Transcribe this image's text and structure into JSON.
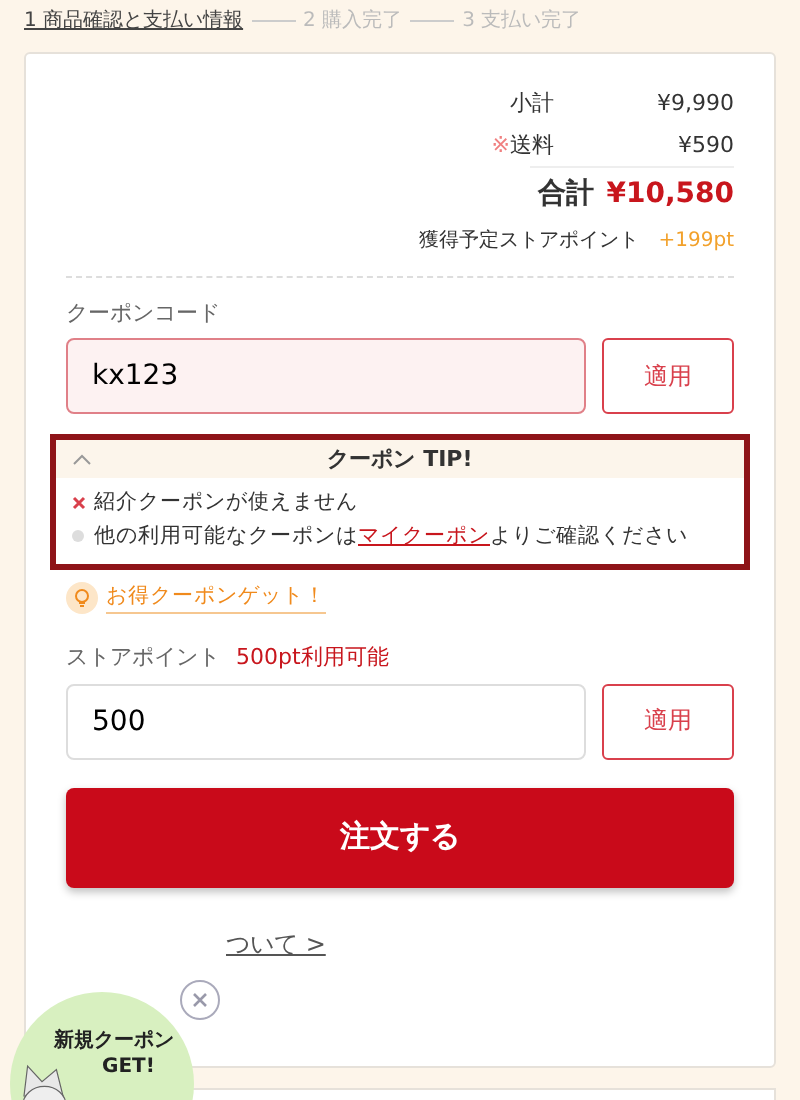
{
  "steps": [
    {
      "label": "1 商品確認と支払い情報",
      "selected": true
    },
    {
      "label": "2 購入完了",
      "selected": false
    },
    {
      "label": "3 支払い完了",
      "selected": false
    }
  ],
  "summary": {
    "rows": [
      {
        "label": "小計",
        "value": "¥9,990"
      },
      {
        "mark": "※",
        "label": "送料",
        "value": "¥590"
      }
    ],
    "total": {
      "label": "合計",
      "value": "¥10,580"
    },
    "points": {
      "label": "獲得予定ストアポイント",
      "value": "+199pt"
    }
  },
  "coupon": {
    "label": "クーポンコード",
    "value": "kx123",
    "error": true,
    "button": "適用"
  },
  "tip": {
    "title": "クーポン TIP!",
    "expanded": true,
    "items": [
      {
        "kind": "error",
        "text": "紹介クーポンが使えません"
      },
      {
        "kind": "info",
        "before": "他の利用可能なクーポンは",
        "link": "マイクーポン",
        "after": "よりご確認ください"
      }
    ]
  },
  "get_coupon": "お得クーポンゲット！",
  "store_points": {
    "label": "ストアポイント",
    "available": "500pt利用可能",
    "value": "500",
    "error": false,
    "button": "適用"
  },
  "order_button": "注文する",
  "footer_link": "ついて >",
  "promo_badge": {
    "lines": [
      "新規クーポン",
      "GET!"
    ]
  }
}
